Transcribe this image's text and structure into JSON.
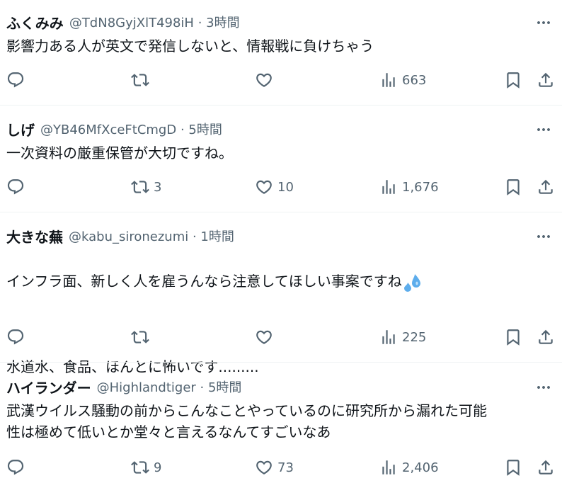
{
  "tweets": [
    {
      "name": "ふくみみ",
      "meta": "@TdN8GyjXlT498iH · 3時間",
      "text": "影響力ある人が英文で発信しないと、情報戦に負けちゃう",
      "reply_count": "",
      "retweet_count": "",
      "like_count": "",
      "view_count": "663"
    },
    {
      "name": "しげ",
      "meta": "@YB46MfXceFtCmgD · 5時間",
      "text": "一次資料の厳重保管が大切ですね。",
      "reply_count": "",
      "retweet_count": "3",
      "like_count": "10",
      "view_count": "1,676"
    },
    {
      "name": "大きな蕪",
      "meta": "@kabu_sironezumi · 1時間",
      "text_line1": "インフラ面、新しく人を雇うんなら注意してほしい事案ですね",
      "text_line2": "水道水、食品、ほんとに怖いです.........",
      "reply_count": "",
      "retweet_count": "",
      "like_count": "",
      "view_count": "225"
    },
    {
      "name": "ハイランダー",
      "meta": "@Highlandtiger · 5時間",
      "text": "武漢ウイルス騒動の前からこんなことやっているのに研究所から漏れた可能\n性は極めて低いとか堂々と言えるなんてすごいなあ",
      "reply_count": "",
      "retweet_count": "9",
      "like_count": "73",
      "view_count": "2,406"
    }
  ],
  "icons": {
    "reply": "reply-icon",
    "retweet": "retweet-icon",
    "like": "heart-icon",
    "views": "views-icon",
    "bookmark": "bookmark-icon",
    "share": "share-icon",
    "more": "more-icon",
    "emoji": "sweat-droplets-emoji"
  },
  "colors": {
    "text": "#0f1419",
    "secondary": "#536471",
    "divider": "#eff3f4",
    "emoji": "#5dadec"
  }
}
